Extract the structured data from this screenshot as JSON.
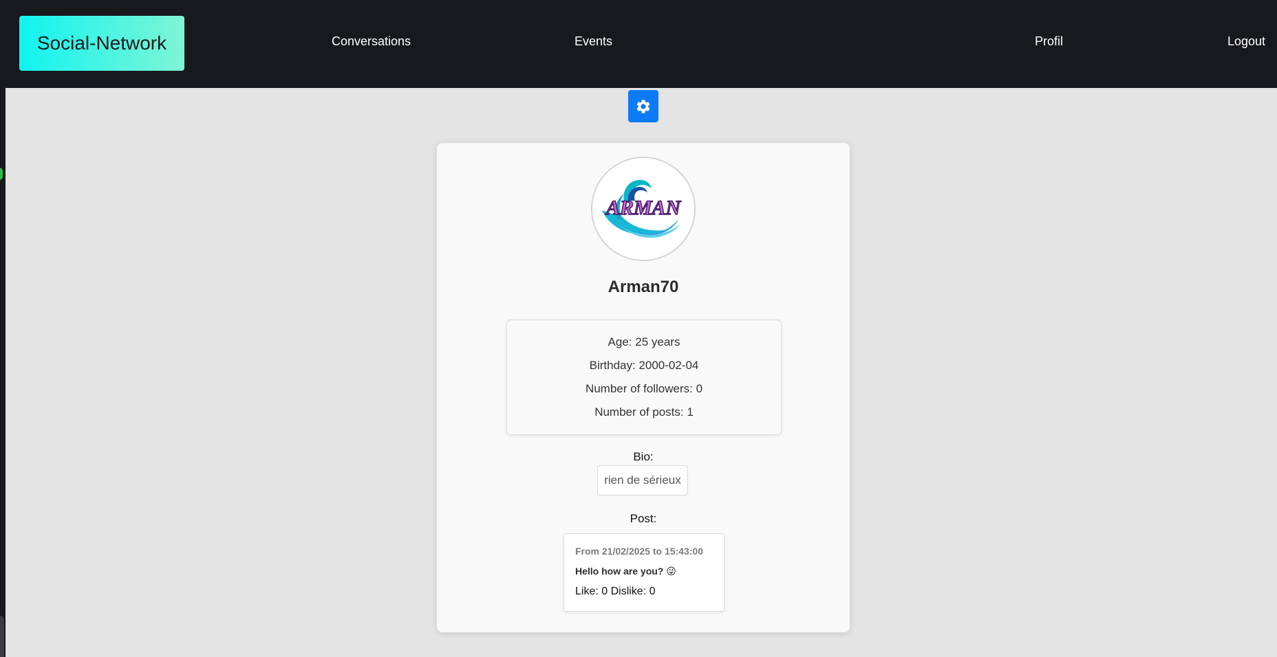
{
  "nav": {
    "brand": "Social-Network",
    "links": {
      "conversations": "Conversations",
      "events": "Events",
      "profil": "Profil",
      "logout": "Logout"
    }
  },
  "toolbar": {
    "settings_icon": "gear-icon"
  },
  "profile": {
    "avatar_text": "ARMAN",
    "username": "Arman70",
    "info": {
      "age": "Age: 25 years",
      "birthday": "Birthday: 2000-02-04",
      "followers": "Number of followers: 0",
      "posts": "Number of posts: 1"
    },
    "bio_label": "Bio:",
    "bio_value": "rien de sérieux",
    "post_label": "Post:"
  },
  "post": {
    "date": "From 21/02/2025 to 15:43:00",
    "text": "Hello how are you? 😜",
    "stats": "Like: 0 Dislike: 0"
  },
  "colors": {
    "navbar": "#18191d",
    "brand_gradient_start": "#11f3f0",
    "brand_gradient_end": "#7ef5d5",
    "settings_button": "#0d7bf7",
    "page_background": "#e4e4e4"
  }
}
